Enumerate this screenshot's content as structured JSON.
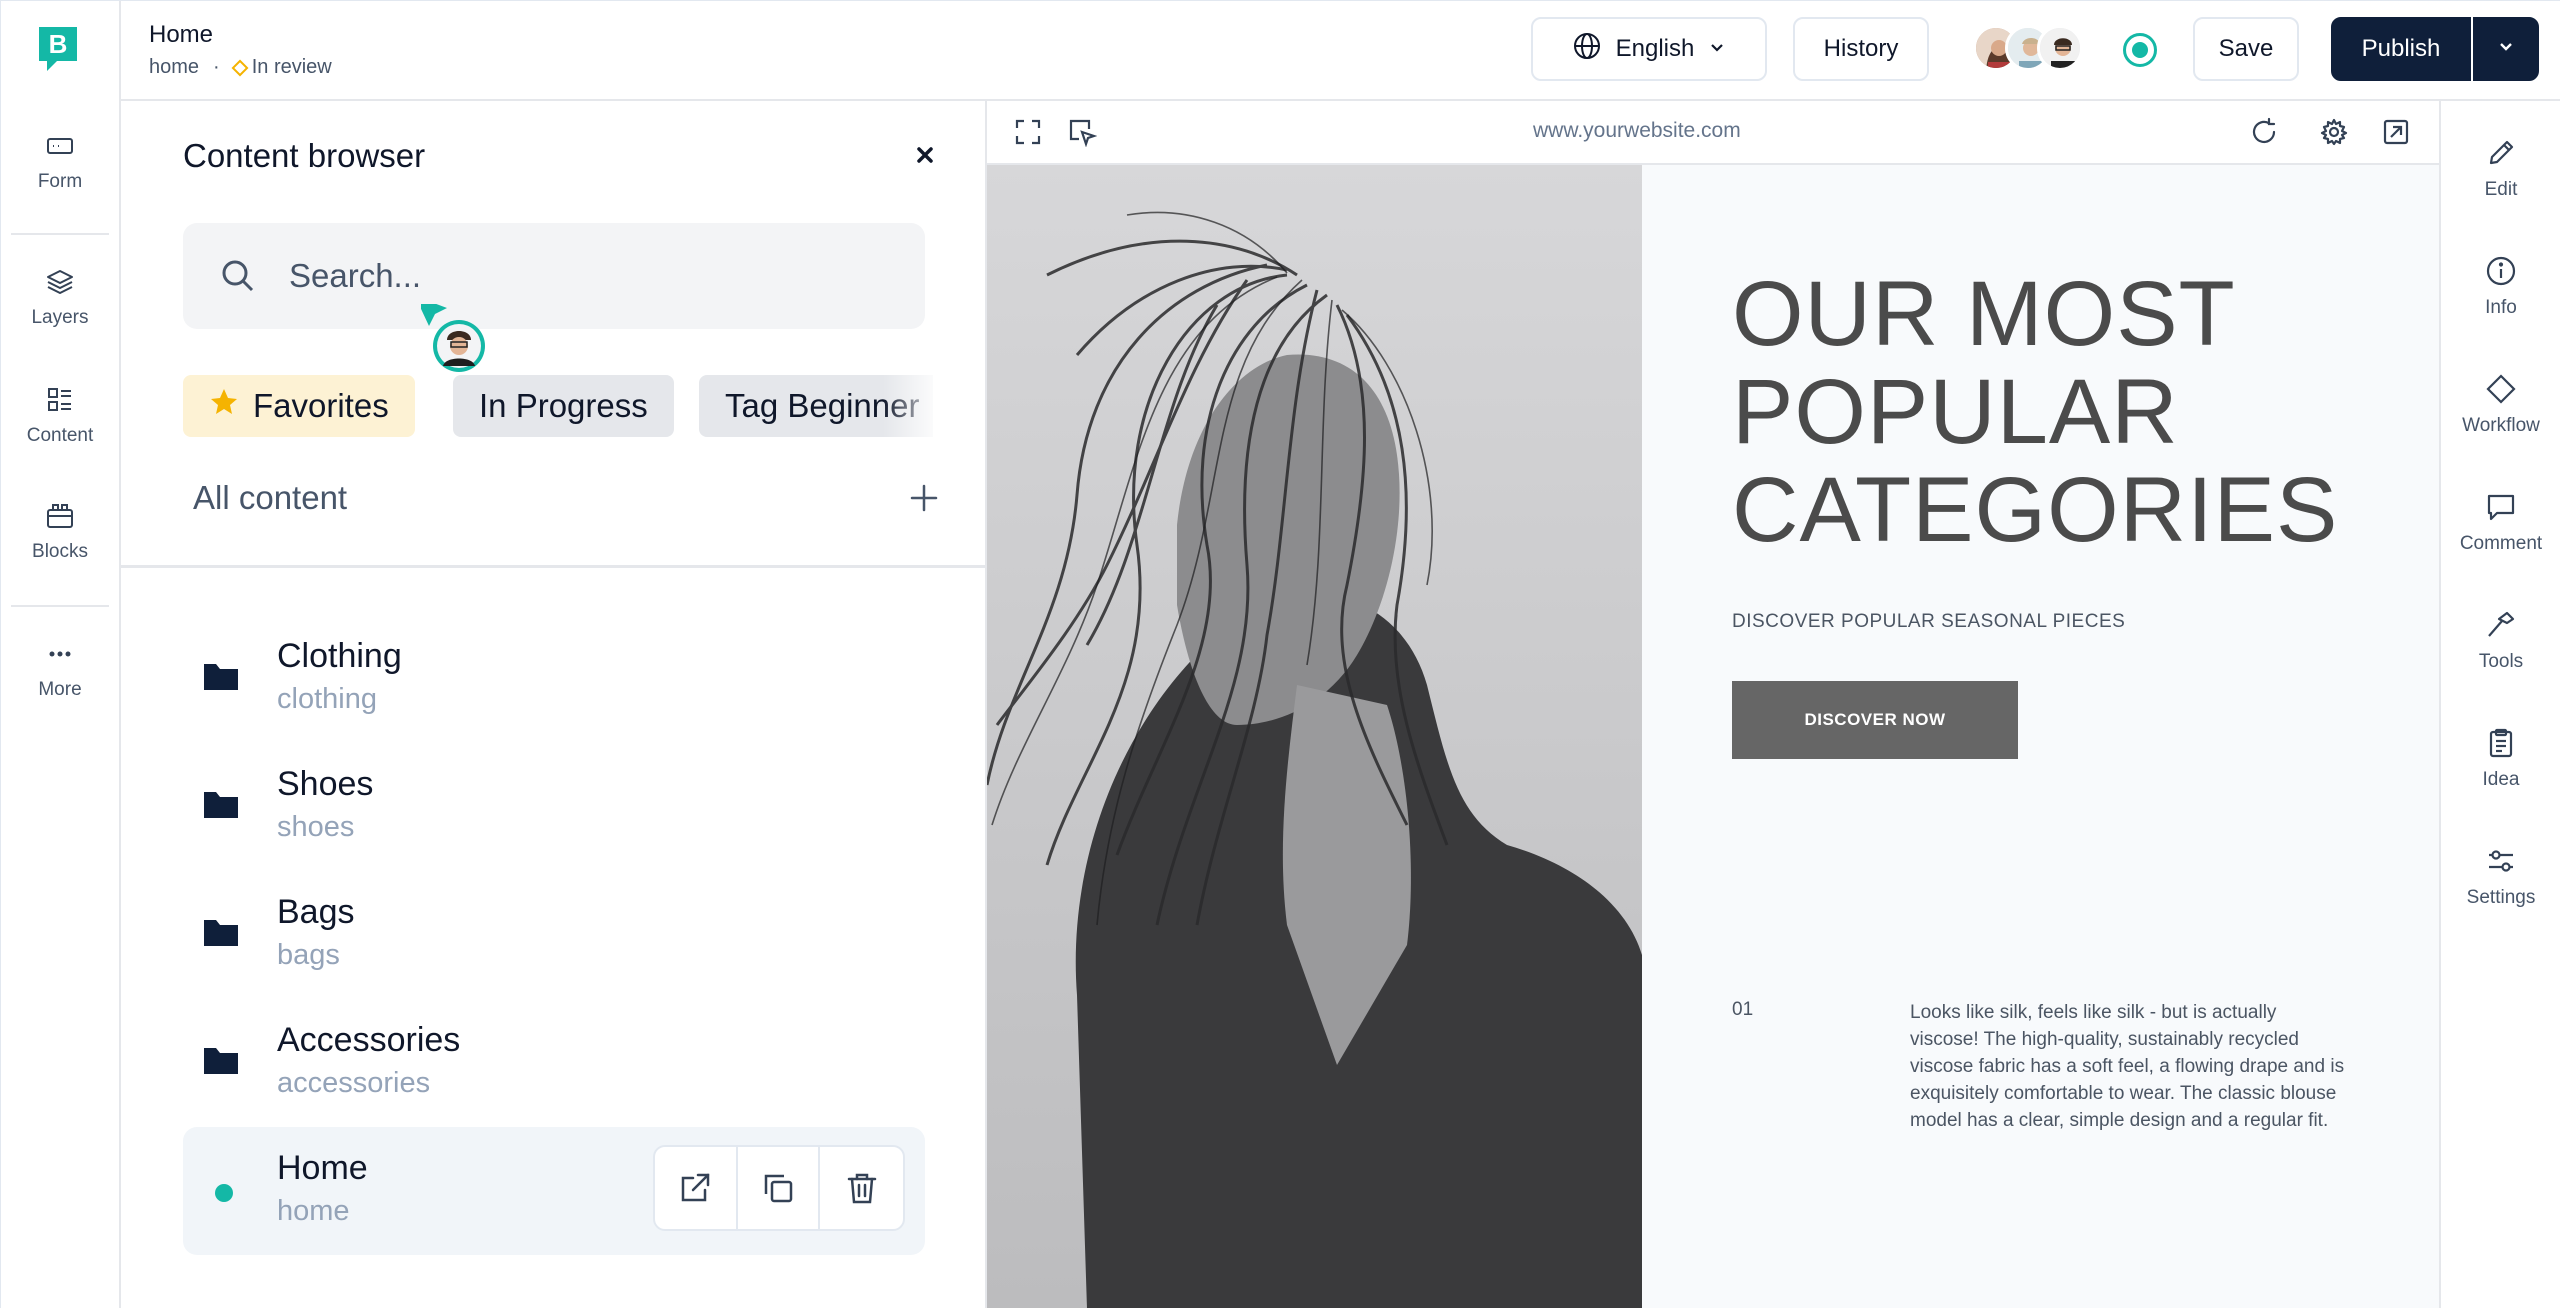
{
  "app": {
    "logo_letter": "B",
    "accent_color": "#14b8a6",
    "primary_dark": "#0f1f3a"
  },
  "left_rail": {
    "items": [
      {
        "label": "Form",
        "icon": "form-icon"
      },
      {
        "label": "Layers",
        "icon": "layers-icon"
      },
      {
        "label": "Content",
        "icon": "content-icon"
      },
      {
        "label": "Blocks",
        "icon": "blocks-icon"
      },
      {
        "label": "More",
        "icon": "more-icon"
      }
    ]
  },
  "header": {
    "title": "Home",
    "slug": "home",
    "separator": "·",
    "status": "In review",
    "language": "English",
    "history": "History",
    "save": "Save",
    "publish": "Publish"
  },
  "panel": {
    "title": "Content browser",
    "search_placeholder": "Search...",
    "chips": [
      "Favorites",
      "In Progress",
      "Tag Beginner"
    ],
    "all_content": "All content",
    "items": [
      {
        "name": "Clothing",
        "slug": "clothing",
        "type": "folder"
      },
      {
        "name": "Shoes",
        "slug": "shoes",
        "type": "folder"
      },
      {
        "name": "Bags",
        "slug": "bags",
        "type": "folder"
      },
      {
        "name": "Accessories",
        "slug": "accessories",
        "type": "folder"
      },
      {
        "name": "Home",
        "slug": "home",
        "type": "page",
        "active": true
      }
    ]
  },
  "preview": {
    "url": "www.yourwebsite.com",
    "hero_title_lines": [
      "OUR MOST",
      "POPULAR",
      "CATEGORIES"
    ],
    "hero_subtitle": "DISCOVER POPULAR SEASONAL PIECES",
    "cta": "DISCOVER NOW",
    "number": "01",
    "description": "Looks like silk, feels like silk - but is actually viscose! The high-quality, sustainably recycled viscose fabric has a soft feel, a flowing drape and is exquisitely comfortable to wear. The classic blouse model has a clear, simple design and a regular fit."
  },
  "right_rail": {
    "items": [
      {
        "label": "Edit",
        "icon": "pencil-icon"
      },
      {
        "label": "Info",
        "icon": "info-icon"
      },
      {
        "label": "Workflow",
        "icon": "workflow-icon"
      },
      {
        "label": "Comment",
        "icon": "comment-icon"
      },
      {
        "label": "Tools",
        "icon": "hammer-icon"
      },
      {
        "label": "Idea",
        "icon": "clipboard-icon"
      },
      {
        "label": "Settings",
        "icon": "sliders-icon"
      }
    ]
  }
}
